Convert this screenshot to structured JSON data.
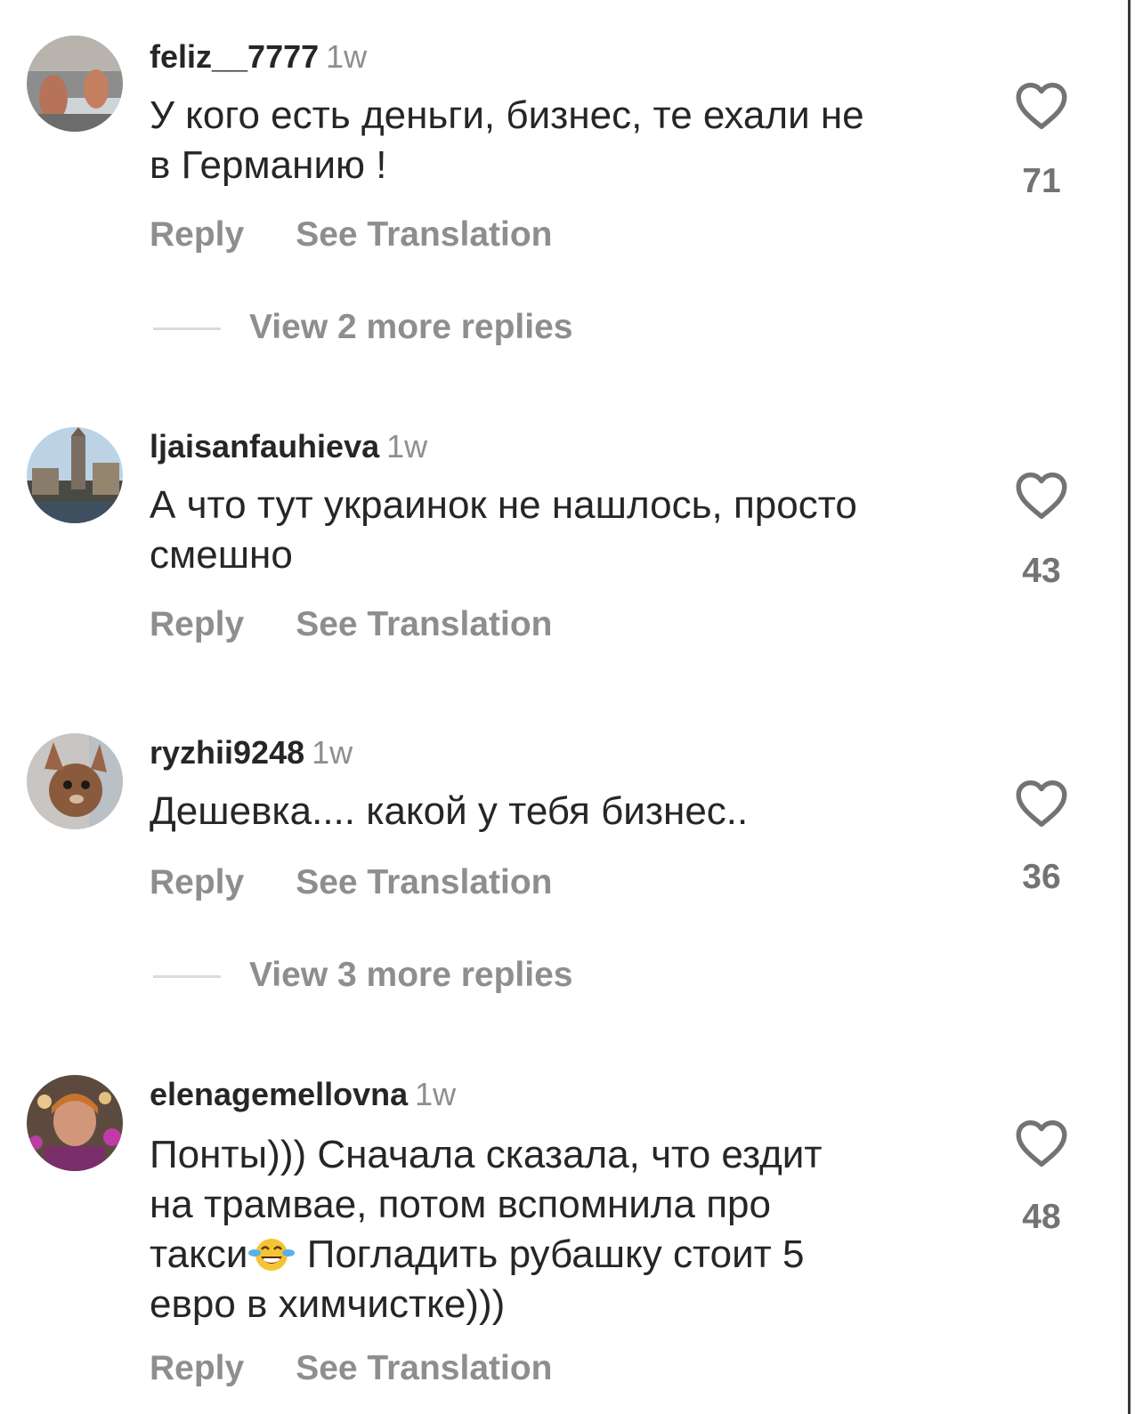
{
  "comments": [
    {
      "username": "feliz__7777",
      "time": "1w",
      "text_lines": [
        "У кого есть деньги, бизнес, те ехали не",
        "в Германию !"
      ],
      "likes": "71",
      "reply_label": "Reply",
      "translate_label": "See Translation",
      "view_replies": "View 2 more replies"
    },
    {
      "username": "ljaisanfauhieva",
      "time": "1w",
      "text_lines": [
        "А что тут украинок не нашлось, просто",
        "смешно"
      ],
      "likes": "43",
      "reply_label": "Reply",
      "translate_label": "See Translation"
    },
    {
      "username": "ryzhii9248",
      "time": "1w",
      "text_lines": [
        "Дешевка.... какой у тебя бизнес.."
      ],
      "likes": "36",
      "reply_label": "Reply",
      "translate_label": "See Translation",
      "view_replies": "View 3 more replies"
    },
    {
      "username": "elenagemellovna",
      "time": "1w",
      "text_lines": [
        "Понты))) Сначала сказала, что ездит",
        "на трамвае, потом вспомнила про",
        "такси",
        "Погладить рубашку стоит 5",
        "евро в химчистке)))"
      ],
      "emoji": "face-with-tears-of-joy",
      "likes": "48",
      "reply_label": "Reply",
      "translate_label": "See Translation"
    }
  ],
  "icons": {
    "like": "heart-outline-icon"
  },
  "colors": {
    "text": "#262626",
    "secondary": "#8e8e8e",
    "divider": "#dbdbdb"
  }
}
